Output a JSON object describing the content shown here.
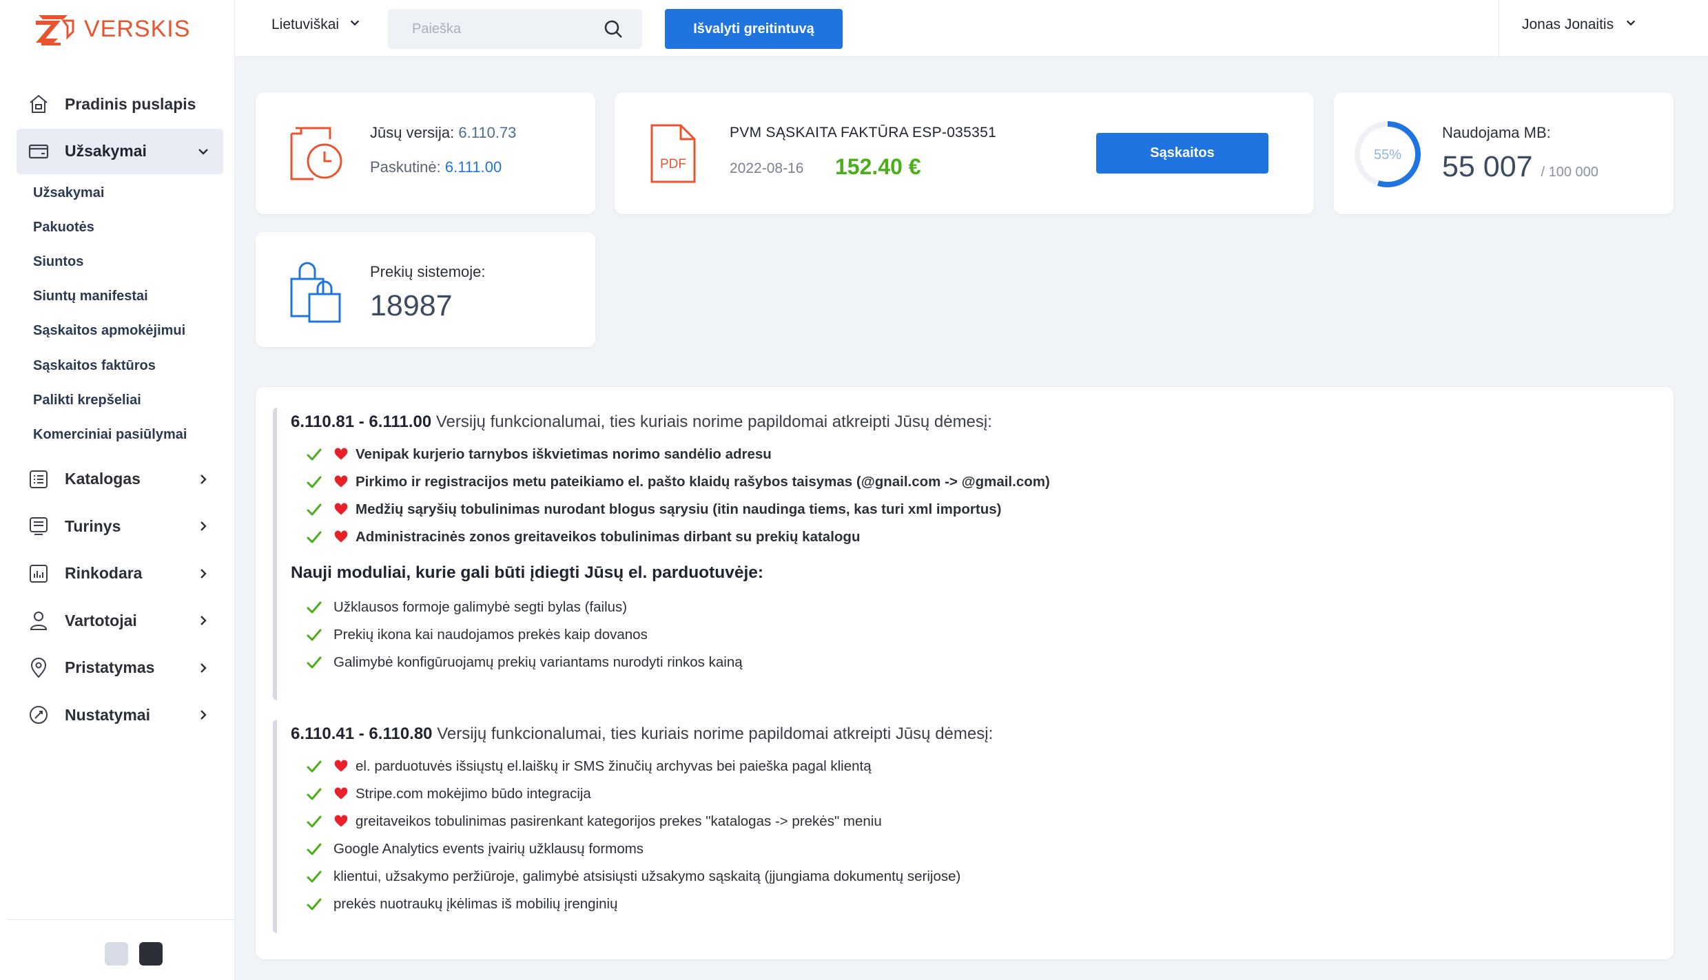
{
  "brand": {
    "name": "VERSKIS",
    "color": "#e8542f"
  },
  "colors": {
    "accent": "#1f74e0",
    "success": "#4caf1a",
    "heart": "#e8202a",
    "check": "#4caf1a"
  },
  "header": {
    "language": "Lietuviškai",
    "search_placeholder": "Paieška",
    "clear_cache_label": "Išvalyti greitintuvą",
    "user_name": "Jonas Jonaitis"
  },
  "sidebar": {
    "items": [
      {
        "label": "Pradinis puslapis",
        "icon": "home-icon"
      },
      {
        "label": "Užsakymai",
        "icon": "orders-icon",
        "expanded": true,
        "children": [
          "Užsakymai",
          "Pakuotės",
          "Siuntos",
          "Siuntų manifestai",
          "Sąskaitos apmokėjimui",
          "Sąskaitos faktūros",
          "Palikti krepšeliai",
          "Komerciniai pasiūlymai"
        ]
      },
      {
        "label": "Katalogas",
        "icon": "list-icon"
      },
      {
        "label": "Turinys",
        "icon": "content-icon"
      },
      {
        "label": "Rinkodara",
        "icon": "chart-icon"
      },
      {
        "label": "Vartotojai",
        "icon": "user-icon"
      },
      {
        "label": "Pristatymas",
        "icon": "location-pin-icon"
      },
      {
        "label": "Nustatymai",
        "icon": "settings-icon"
      }
    ]
  },
  "version_card": {
    "label": "Jūsų versija:",
    "version": "6.110.73",
    "last_label": "Paskutinė:",
    "last_version": "6.111.00"
  },
  "invoice_card": {
    "title": "PVM SĄSKAITA FAKTŪRA ESP-035351",
    "date": "2022-08-16",
    "amount": "152.40 €",
    "button_label": "Sąskaitos",
    "file_type": "PDF"
  },
  "mb_card": {
    "label": "Naudojama MB:",
    "used": "55 007",
    "total": "/ 100 000",
    "percent_text": "55%",
    "percent": 0.55
  },
  "products_card": {
    "label": "Prekių sistemoje:",
    "count": "18987"
  },
  "news": {
    "section1": {
      "range": "6.110.81 - 6.111.00",
      "headline": " Versijų funkcionalumai, ties kuriais norime papildomai atkreipti Jūsų dėmesį:",
      "highlights": [
        "Venipak kurjerio tarnybos iškvietimas norimo sandėlio adresu",
        "Pirkimo ir registracijos metu pateikiamo el. pašto klaidų rašybos taisymas (@gnail.com -> @gmail.com)",
        "Medžių sąryšių tobulinimas nurodant blogus sąrysiu (itin naudinga tiems, kas turi xml importus)",
        "Administracinės zonos greitaveikos tobulinimas dirbant su prekių katalogu"
      ],
      "modules_title": "Nauji moduliai, kurie gali būti įdiegti Jūsų el. parduotuvėje:",
      "modules": [
        "Užklausos formoje galimybė segti bylas (failus)",
        "Prekių ikona kai naudojamos prekės kaip dovanos",
        "Galimybė konfigūruojamų prekių variantams nurodyti rinkos kainą"
      ]
    },
    "section2": {
      "range": "6.110.41 - 6.110.80",
      "headline": " Versijų funkcionalumai, ties kuriais norime papildomai atkreipti Jūsų dėmesį:",
      "highlights": [
        "el. parduotuvės išsiųstų el.laiškų ir SMS žinučių archyvas bei paieška pagal klientą",
        "Stripe.com mokėjimo būdo integracija",
        "greitaveikos tobulinimas pasirenkant kategorijos prekes \"katalogas -> prekės\" meniu"
      ],
      "items": [
        "Google Analytics events įvairių užklausų formoms",
        "klientui, užsakymo peržiūroje, galimybė atsisiųsti užsakymo sąskaitą (įjungiama dokumentų serijose)",
        "prekės nuotraukų įkėlimas iš mobilių įrenginių"
      ]
    }
  }
}
